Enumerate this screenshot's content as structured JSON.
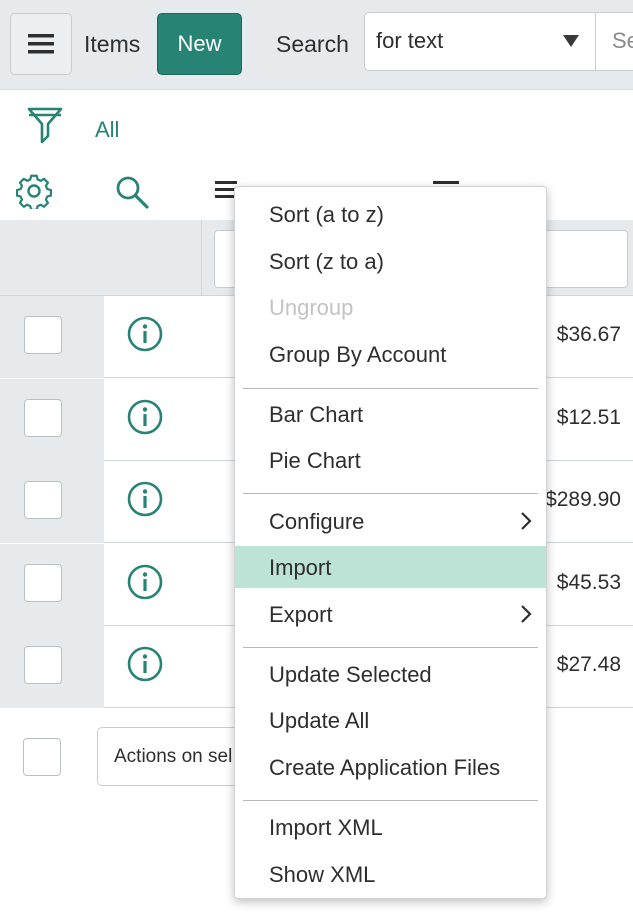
{
  "header": {
    "title": "Items",
    "new_label": "New",
    "search_label": "Search",
    "search_field_value": "for text",
    "search_placeholder": "Se"
  },
  "filter": {
    "label": "All"
  },
  "rows": [
    {
      "amount": "$36.67"
    },
    {
      "amount": "$12.51"
    },
    {
      "amount": "$289.90"
    },
    {
      "amount": "$45.53"
    },
    {
      "amount": "$27.48"
    }
  ],
  "footer": {
    "actions_label": "Actions on sel"
  },
  "menu": {
    "sort_az": "Sort (a to z)",
    "sort_za": "Sort (z to a)",
    "ungroup": "Ungroup",
    "group_by": "Group By Account",
    "bar_chart": "Bar Chart",
    "pie_chart": "Pie Chart",
    "configure": "Configure",
    "import": "Import",
    "export": "Export",
    "update_selected": "Update Selected",
    "update_all": "Update All",
    "create_app_files": "Create Application Files",
    "import_xml": "Import XML",
    "show_xml": "Show XML"
  },
  "colors": {
    "accent": "#278374",
    "menu_highlight": "#bde3d7",
    "band": "#e6eaec"
  },
  "icons": [
    "hamburger-icon",
    "funnel-icon",
    "gear-icon",
    "search-icon",
    "columns-icon",
    "info-icon",
    "chevron-right-icon",
    "caret-down-icon"
  ]
}
